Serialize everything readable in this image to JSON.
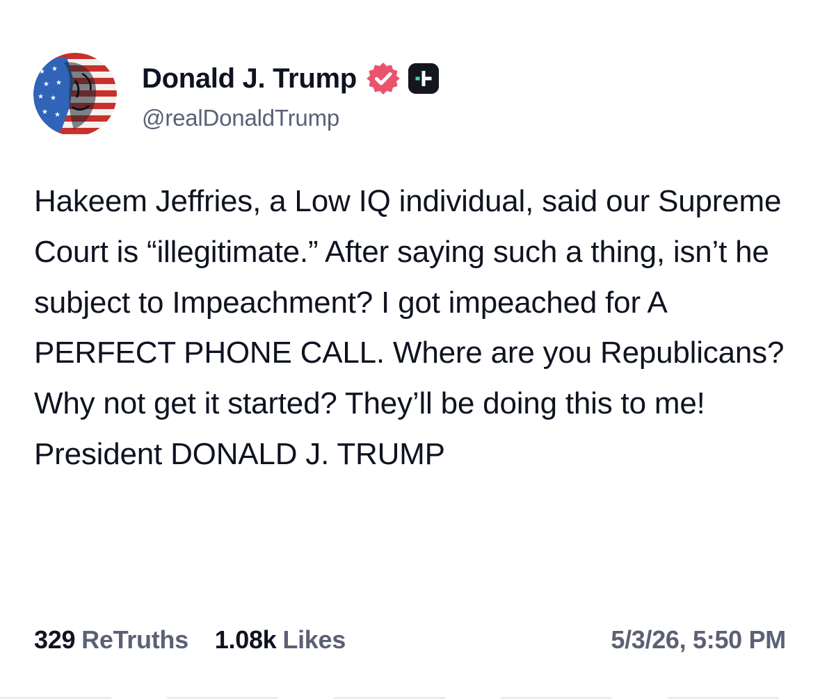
{
  "post": {
    "author": {
      "display_name": "Donald J. Trump",
      "handle": "@realDonaldTrump",
      "avatar_icon": "flag-portrait-avatar",
      "verified_icon": "verified-badge-icon",
      "verified_color": "#e8546e",
      "plus_badge_icon": "truth-plus-icon",
      "plus_badge_color": "#14161f",
      "plus_accent_color": "#3ed6b8"
    },
    "text": "Hakeem Jeffries, a Low IQ individual, said our Supreme Court is “illegitimate.” After saying such a thing, isn’t he subject to Impeachment? I got impeached for A PERFECT PHONE CALL. Where are you Republicans? Why not get it started? They’ll be doing this to me! President DONALD J. TRUMP",
    "stats": {
      "retruths_count": "329",
      "retruths_label": "ReTruths",
      "likes_count": "1.08k",
      "likes_label": "Likes"
    },
    "timestamp": "5/3/26, 5:50 PM"
  }
}
